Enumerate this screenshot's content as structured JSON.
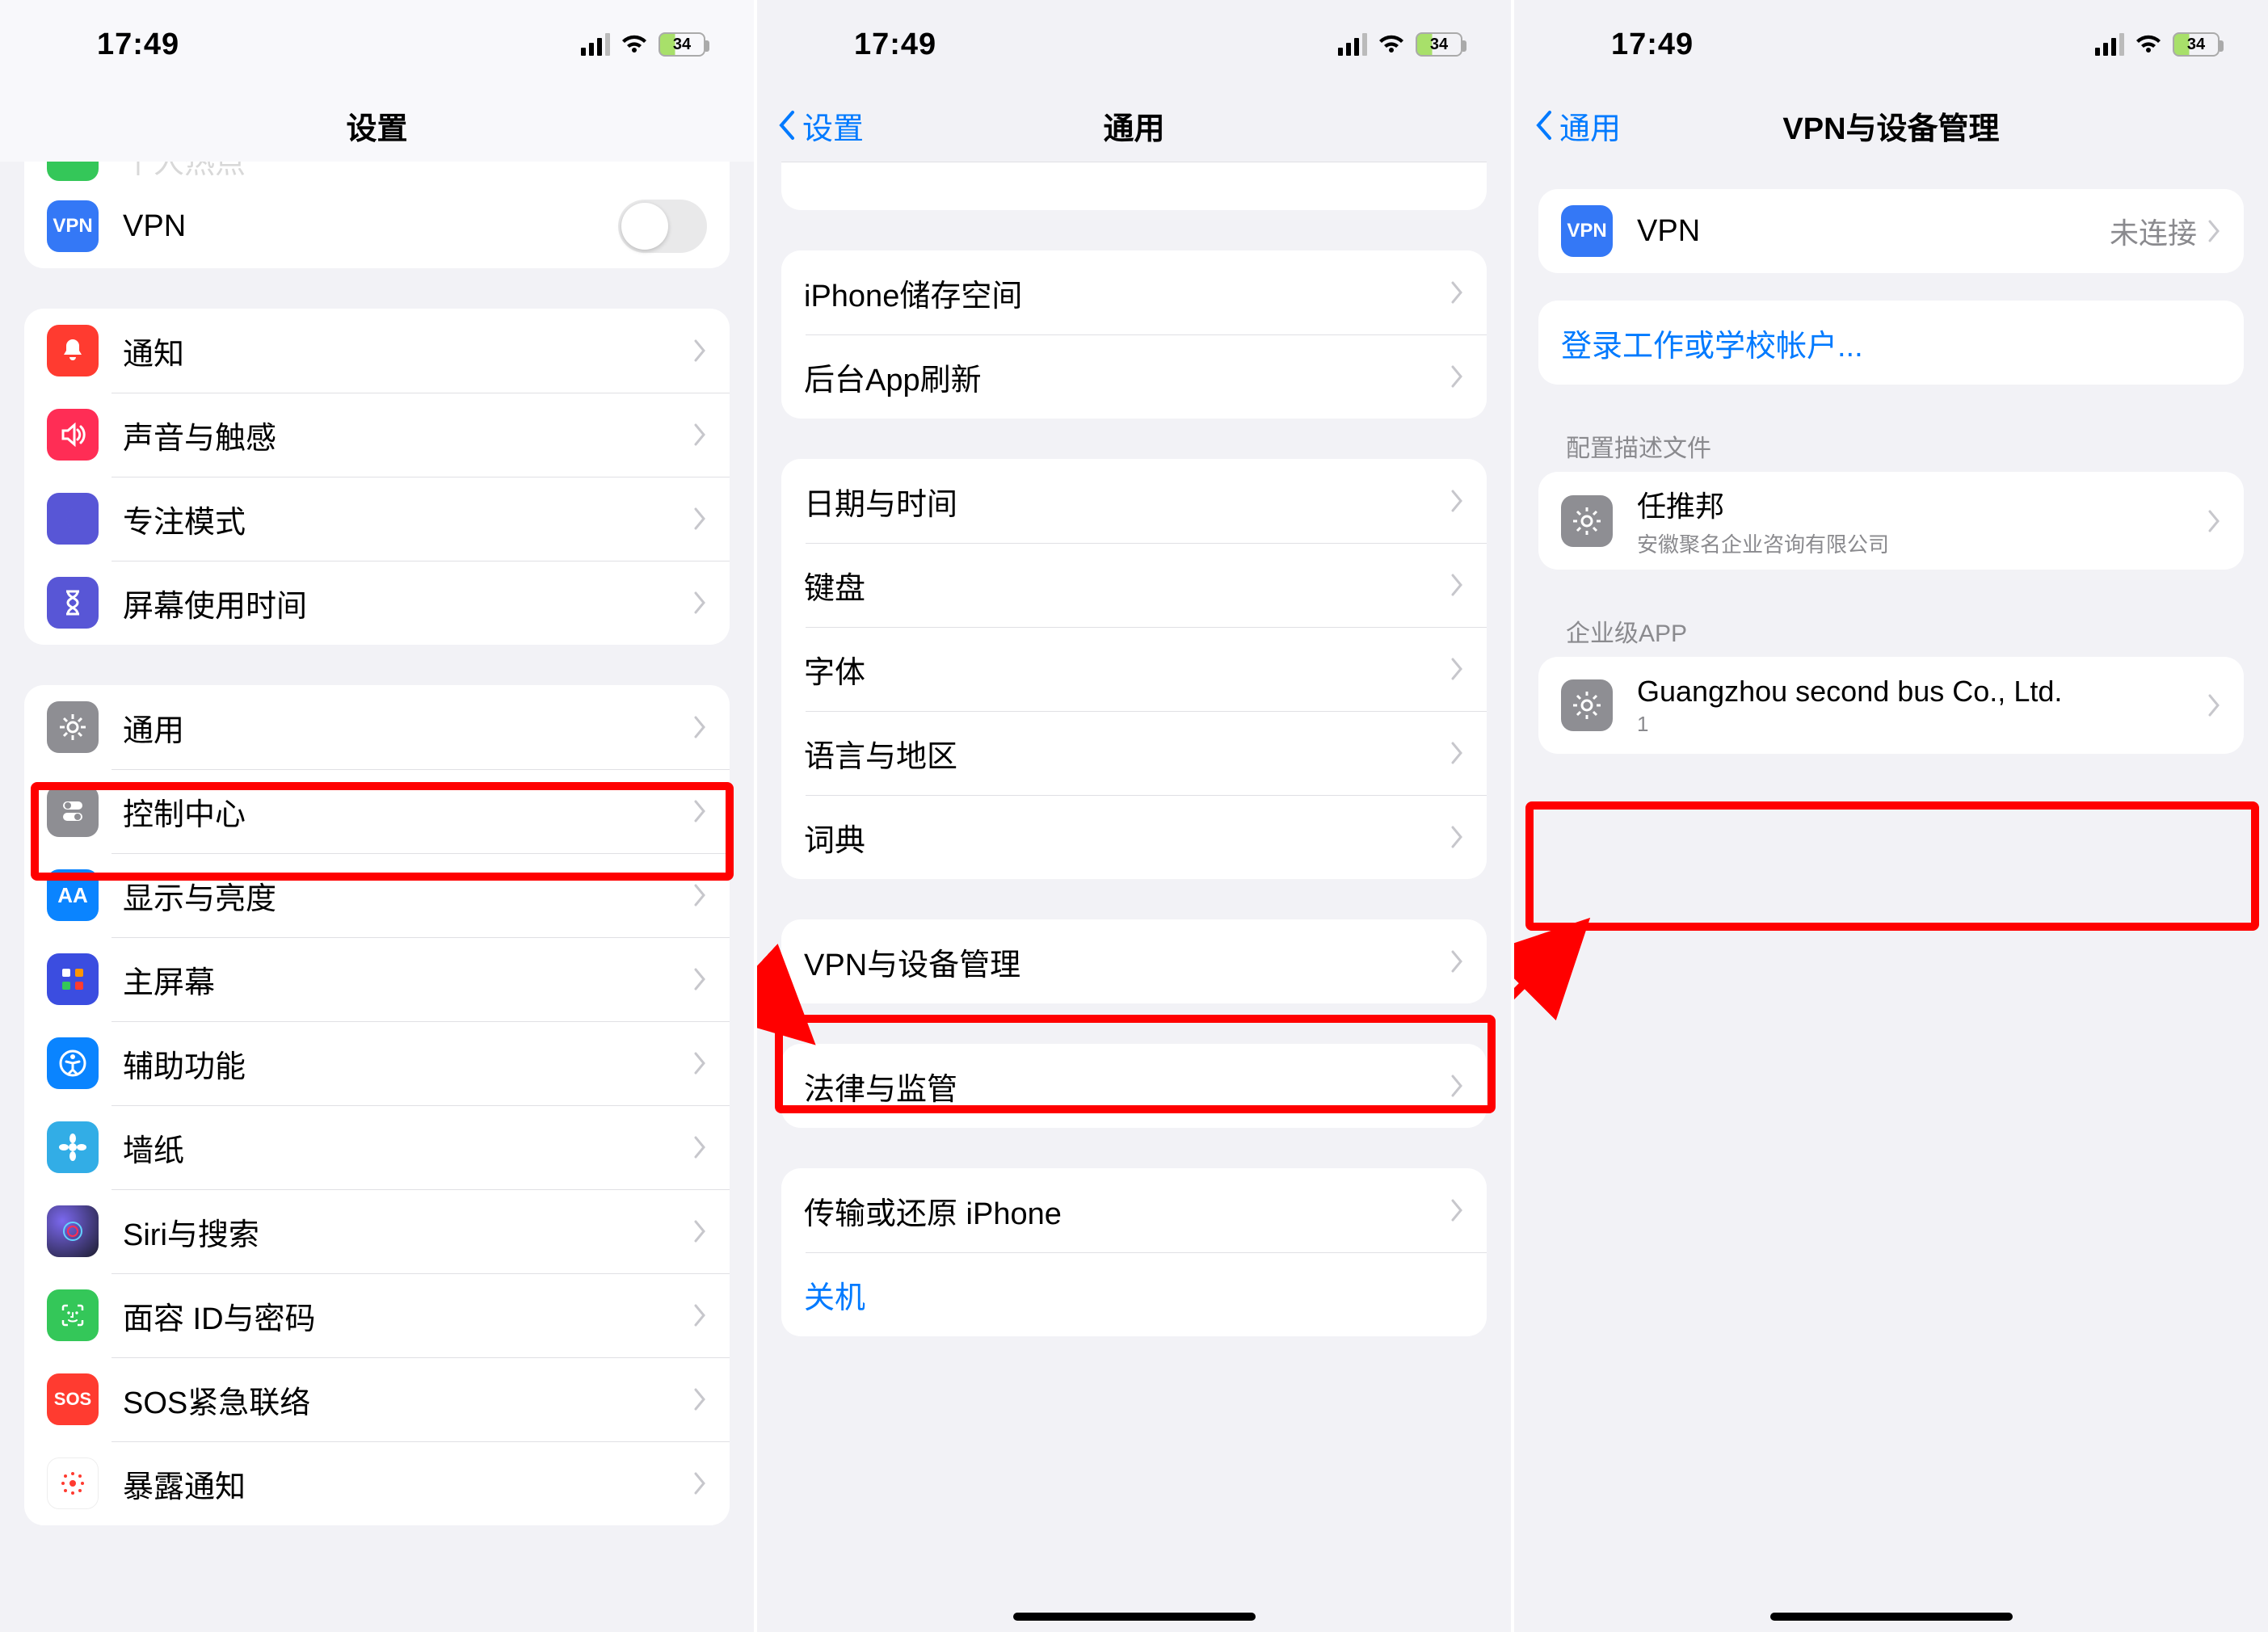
{
  "status": {
    "time": "17:49",
    "battery": "34"
  },
  "screen1": {
    "nav_title": "设置",
    "vpn_label": "VPN",
    "items_a": [
      {
        "label": "通知"
      },
      {
        "label": "声音与触感"
      },
      {
        "label": "专注模式"
      },
      {
        "label": "屏幕使用时间"
      }
    ],
    "items_b": [
      {
        "label": "通用"
      },
      {
        "label": "控制中心"
      },
      {
        "label": "显示与亮度"
      },
      {
        "label": "主屏幕"
      },
      {
        "label": "辅助功能"
      },
      {
        "label": "墙纸"
      },
      {
        "label": "Siri与搜索"
      },
      {
        "label": "面容 ID与密码"
      },
      {
        "label": "SOS紧急联络"
      },
      {
        "label": "暴露通知"
      }
    ]
  },
  "screen2": {
    "nav_back": "设置",
    "nav_title": "通用",
    "group_a": [
      {
        "label": "iPhone储存空间"
      },
      {
        "label": "后台App刷新"
      }
    ],
    "group_b": [
      {
        "label": "日期与时间"
      },
      {
        "label": "键盘"
      },
      {
        "label": "字体"
      },
      {
        "label": "语言与地区"
      },
      {
        "label": "词典"
      }
    ],
    "group_c": [
      {
        "label": "VPN与设备管理"
      }
    ],
    "group_d": [
      {
        "label": "法律与监管"
      }
    ],
    "group_e": [
      {
        "label": "传输或还原 iPhone"
      }
    ],
    "shutdown": "关机"
  },
  "screen3": {
    "nav_back": "通用",
    "nav_title": "VPN与设备管理",
    "vpn_label": "VPN",
    "vpn_status": "未连接",
    "login_link": "登录工作或学校帐户...",
    "section_profile": "配置描述文件",
    "profile_title": "任推邦",
    "profile_sub": "安徽聚名企业咨询有限公司",
    "section_enterprise": "企业级APP",
    "enterprise_title": "Guangzhou second bus Co., Ltd.",
    "enterprise_sub": "1"
  }
}
